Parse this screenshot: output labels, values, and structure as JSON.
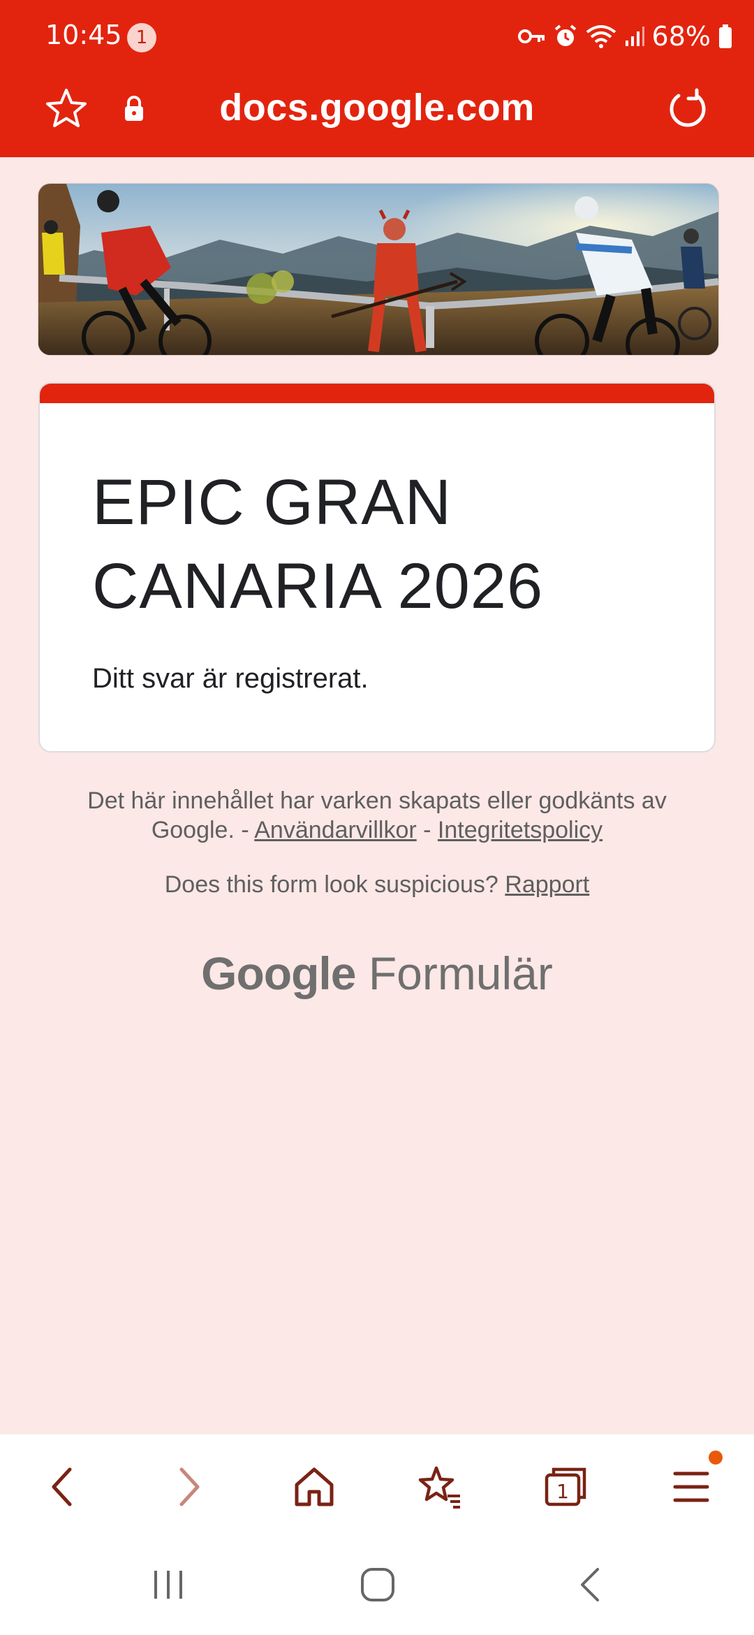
{
  "status_bar": {
    "time": "10:45",
    "notification_count": "1",
    "battery": "68%"
  },
  "browser": {
    "url": "docs.google.com"
  },
  "form": {
    "title": "EPIC GRAN CANARIA 2026",
    "confirmation": "Ditt svar är registrerat."
  },
  "footer": {
    "disclaimer_prefix": "Det här innehållet har varken skapats eller godkänts av Google. - ",
    "terms_link": "Användarvillkor",
    "separator": " - ",
    "privacy_link": "Integritetspolicy",
    "suspicious_text": "Does this form look suspicious? ",
    "report_link": "Rapport",
    "brand_google": "Google",
    "brand_product": "Formulär"
  },
  "tabs_count": "1",
  "colors": {
    "accent": "#e2240f",
    "background": "#fce8e6",
    "icon_dark": "#7a2314",
    "menu_dot": "#e8590c"
  },
  "icons": {
    "bookmark": "star-icon",
    "lock": "lock-icon",
    "reload": "reload-icon",
    "back": "chevron-left-icon",
    "forward": "chevron-right-icon",
    "home": "home-icon",
    "bookmarks": "bookmarks-icon",
    "tabs": "tabs-icon",
    "menu": "menu-icon"
  }
}
